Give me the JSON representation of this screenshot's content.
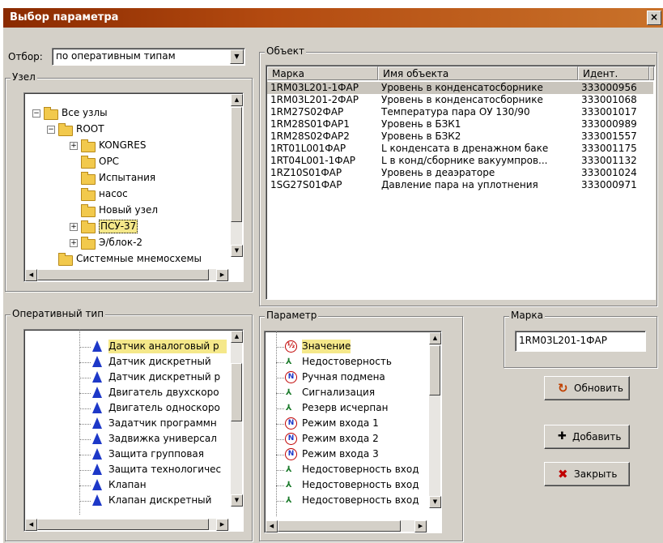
{
  "window": {
    "title": "Выбор параметра",
    "close_glyph": "×"
  },
  "filter": {
    "label": "Отбор:",
    "value": "по оперативным типам"
  },
  "node_group": {
    "caption": "Узел",
    "items": [
      {
        "label": "Все узлы",
        "expander": "−"
      },
      {
        "label": "ROOT",
        "expander": "−"
      },
      {
        "label": "KONGRES",
        "expander": "+"
      },
      {
        "label": "OPC",
        "expander": ""
      },
      {
        "label": "Испытания",
        "expander": ""
      },
      {
        "label": "насос",
        "expander": ""
      },
      {
        "label": "Новый узел",
        "expander": ""
      },
      {
        "label": "ПСУ-37",
        "expander": "+"
      },
      {
        "label": "Э/блок-2",
        "expander": "+"
      },
      {
        "label": "Системные мнемосхемы",
        "expander": ""
      }
    ]
  },
  "object_group": {
    "caption": "Объект",
    "columns": [
      "Марка",
      "Имя объекта",
      "Идент."
    ],
    "rows": [
      [
        "1RM03L201-1ФАР",
        "Уровень в конденсатосборнике",
        "333000956"
      ],
      [
        "1RM03L201-2ФАР",
        "Уровень в конденсатосборнике",
        "333001068"
      ],
      [
        "1RM27S02ФАР",
        "Температура пара ОУ 130/90",
        "333001017"
      ],
      [
        "1RM28S01ФАР1",
        "Уровень в БЗК1",
        "333000989"
      ],
      [
        "1RM28S02ФАР2",
        "Уровень в БЗК2",
        "333001557"
      ],
      [
        "1RT01L001ФАР",
        "L конденсата в дренажном баке",
        "333001175"
      ],
      [
        "1RT04L001-1ФАР",
        "L в конд/сборнике вакуумпров...",
        "333001132"
      ],
      [
        "1RZ10S01ФАР",
        "Уровень в деаэраторе",
        "333001024"
      ],
      [
        "1SG27S01ФАР",
        "Давление пара на уплотнения",
        "333000971"
      ]
    ]
  },
  "optype_group": {
    "caption": "Оперативный тип",
    "items": [
      "Датчик аналоговый р",
      "Датчик дискретный",
      "Датчик дискретный р",
      "Двигатель двухскоро",
      "Двигатель односкоро",
      "Задатчик программн",
      "Задвижка универсал",
      "Защита групповая",
      "Защита технологичес",
      "Клапан",
      "Клапан дискретный"
    ]
  },
  "param_group": {
    "caption": "Параметр",
    "items": [
      {
        "label": "Значение",
        "icon": "value-icon",
        "glyph": "½"
      },
      {
        "label": "Недостоверность",
        "icon": "signal-icon",
        "glyph": "⅄"
      },
      {
        "label": "Ручная подмена",
        "icon": "manual-icon",
        "glyph": "N"
      },
      {
        "label": "Сигнализация",
        "icon": "signal-icon",
        "glyph": "⅄"
      },
      {
        "label": "Резерв исчерпан",
        "icon": "signal-icon",
        "glyph": "⅄"
      },
      {
        "label": "Режим входа 1",
        "icon": "manual-icon",
        "glyph": "N"
      },
      {
        "label": "Режим входа 2",
        "icon": "manual-icon",
        "glyph": "N"
      },
      {
        "label": "Режим входа 3",
        "icon": "manual-icon",
        "glyph": "N"
      },
      {
        "label": "Недостоверность вход",
        "icon": "signal-icon",
        "glyph": "⅄"
      },
      {
        "label": "Недостоверность вход",
        "icon": "signal-icon",
        "glyph": "⅄"
      },
      {
        "label": "Недостоверность вход",
        "icon": "signal-icon",
        "glyph": "⅄"
      }
    ]
  },
  "mark_group": {
    "caption": "Марка",
    "value": "1RM03L201-1ФАР"
  },
  "buttons": {
    "refresh": {
      "label": "Обновить",
      "glyph": "↻"
    },
    "add": {
      "label": "Добавить",
      "glyph": "✚"
    },
    "close": {
      "label": "Закрыть",
      "glyph": "✖"
    }
  },
  "colors": {
    "accent_red": "#c00000",
    "triangle_blue": "#1d38c8",
    "folder_yellow": "#f2c94c"
  }
}
